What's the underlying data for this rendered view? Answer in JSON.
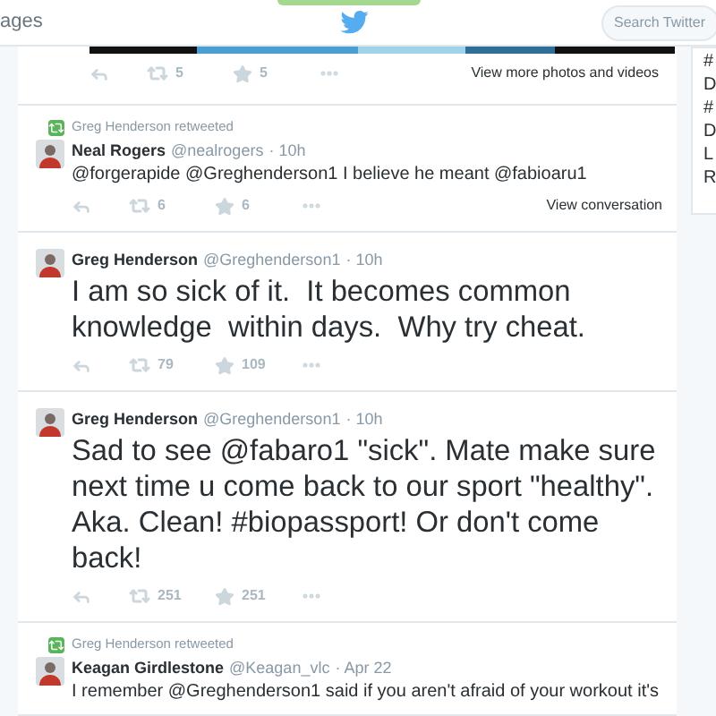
{
  "header": {
    "nav_item": "ages",
    "search": {
      "placeholder": "Search Twitter"
    }
  },
  "tweets": [
    {
      "kind": "media",
      "retweets": "5",
      "favorites": "5",
      "link": "View more photos and videos"
    },
    {
      "kind": "tweet",
      "retweeted_by": "Greg Henderson retweeted",
      "author": "Neal Rogers",
      "handle": "@nealrogers",
      "time": "· 10h",
      "text": "@forgerapide @Greghenderson1 I believe he meant @fabioaru1",
      "large": false,
      "retweets": "6",
      "favorites": "6",
      "link": "View conversation"
    },
    {
      "kind": "tweet",
      "author": "Greg Henderson",
      "handle": "@Greghenderson1",
      "time": "· 10h",
      "text": "I am so sick of it.  It becomes common knowledge  within days.  Why try cheat.",
      "large": true,
      "retweets": "79",
      "favorites": "109"
    },
    {
      "kind": "tweet",
      "author": "Greg Henderson",
      "handle": "@Greghenderson1",
      "time": "· 10h",
      "text": "Sad to see @fabaro1 \"sick\". Mate make sure next time u come back to our sport \"healthy\". Aka. Clean! #biopassport! Or don't come back!",
      "large": true,
      "retweets": "251",
      "favorites": "251"
    },
    {
      "kind": "tweet",
      "retweeted_by": "Greg Henderson retweeted",
      "author": "Keagan Girdlestone",
      "handle": "@Keagan_vlc",
      "time": "· Apr 22",
      "text": "I remember @Greghenderson1 said if you aren't afraid of your workout it's",
      "large": false
    }
  ],
  "sidebar": {
    "items": [
      "#",
      "D",
      "#",
      "D",
      "L",
      "R"
    ]
  }
}
